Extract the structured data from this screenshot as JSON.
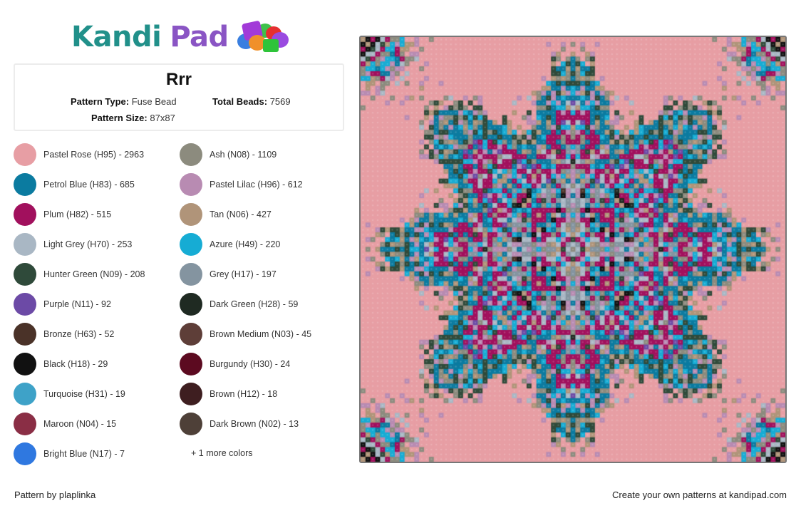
{
  "brand": {
    "name_part1": "Kandi",
    "name_part2": "Pad",
    "logo_icon": "beads-icon"
  },
  "pattern": {
    "title": "Rrr",
    "type_label": "Pattern Type:",
    "type_value": "Fuse Bead",
    "total_label": "Total Beads:",
    "total_value": "7569",
    "size_label": "Pattern Size:",
    "size_value": "87x87",
    "grid_size": 87
  },
  "legend": {
    "left": [
      {
        "label": "Pastel Rose (H95) - 2963",
        "color": "#e79ea4"
      },
      {
        "label": "Petrol Blue (H83) - 685",
        "color": "#0b7ba0"
      },
      {
        "label": "Plum (H82) - 515",
        "color": "#a1105d"
      },
      {
        "label": "Light Grey (H70) - 253",
        "color": "#a9b7c4"
      },
      {
        "label": "Hunter Green (N09) - 208",
        "color": "#2f4a3a"
      },
      {
        "label": "Purple (N11) - 92",
        "color": "#6c4aa6"
      },
      {
        "label": "Bronze (H63) - 52",
        "color": "#4a3228"
      },
      {
        "label": "Black (H18) - 29",
        "color": "#111111"
      },
      {
        "label": "Turquoise (H31) - 19",
        "color": "#3ea2c8"
      },
      {
        "label": "Maroon (N04) - 15",
        "color": "#8a2e45"
      },
      {
        "label": "Bright Blue (N17) - 7",
        "color": "#2f78e0"
      }
    ],
    "right": [
      {
        "label": "Ash (N08) - 1109",
        "color": "#8c8b7e"
      },
      {
        "label": "Pastel Lilac (H96) - 612",
        "color": "#b88bb2"
      },
      {
        "label": "Tan (N06) - 427",
        "color": "#b09479"
      },
      {
        "label": "Azure (H49) - 220",
        "color": "#16acd4"
      },
      {
        "label": "Grey (H17) - 197",
        "color": "#8494a0"
      },
      {
        "label": "Dark Green (H28) - 59",
        "color": "#1f2a22"
      },
      {
        "label": "Brown Medium (N03) - 45",
        "color": "#5e3e38"
      },
      {
        "label": "Burgundy (H30) - 24",
        "color": "#5c0a20"
      },
      {
        "label": "Brown (H12) - 18",
        "color": "#3e1e20"
      },
      {
        "label": "Dark Brown (N02) - 13",
        "color": "#4e4038"
      }
    ],
    "more_label": "+ 1 more colors"
  },
  "footer": {
    "credit": "Pattern by plaplinka",
    "promo": "Create your own patterns at kandipad.com"
  }
}
